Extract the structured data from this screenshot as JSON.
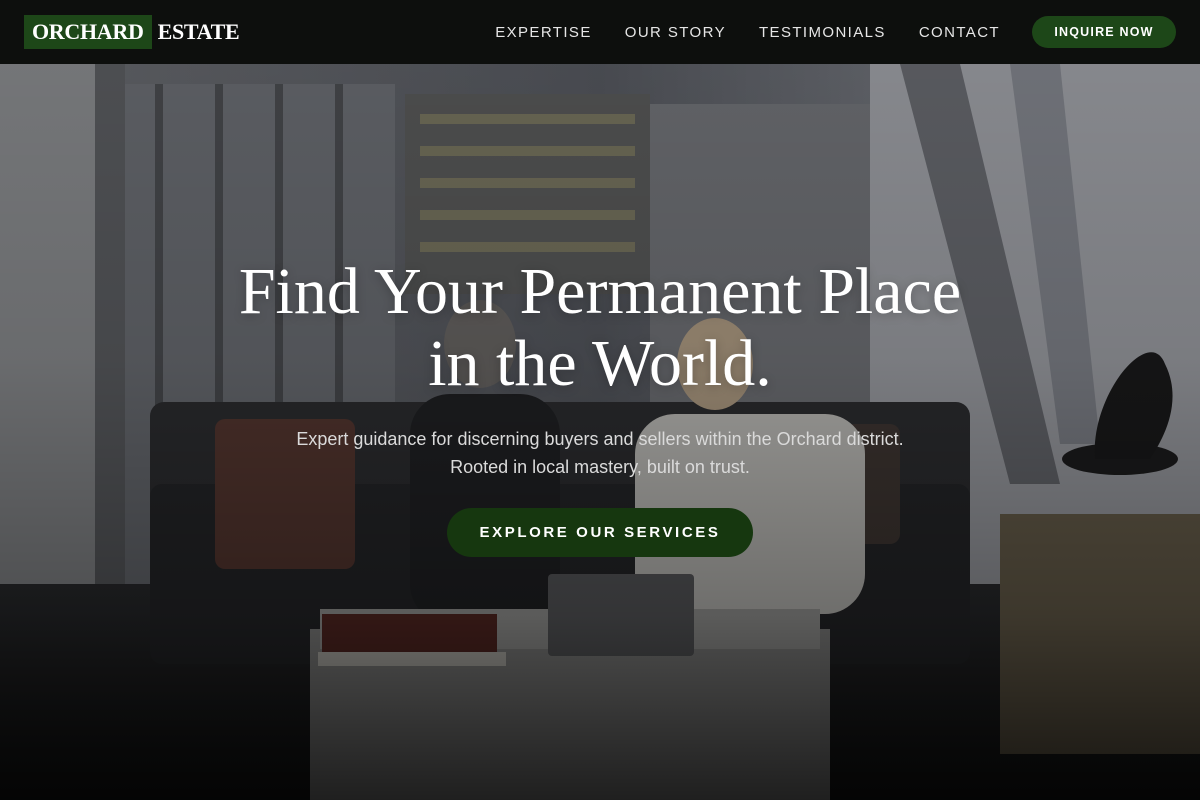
{
  "brand": {
    "name_primary": "ORCHARD",
    "name_secondary": "ESTATE",
    "accent_color": "#1d4718"
  },
  "nav": {
    "links": [
      {
        "label": "EXPERTISE"
      },
      {
        "label": "OUR STORY"
      },
      {
        "label": "TESTIMONIALS"
      },
      {
        "label": "CONTACT"
      }
    ],
    "cta_label": "INQUIRE NOW"
  },
  "hero": {
    "headline_line1": "Find Your Permanent Place",
    "headline_line2": "in the World.",
    "subtitle": "Expert guidance for discerning buyers and sellers within the Orchard district. Rooted in local mastery, built on trust.",
    "cta_label": "EXPLORE OUR SERVICES",
    "cta_color": "#16370f"
  }
}
